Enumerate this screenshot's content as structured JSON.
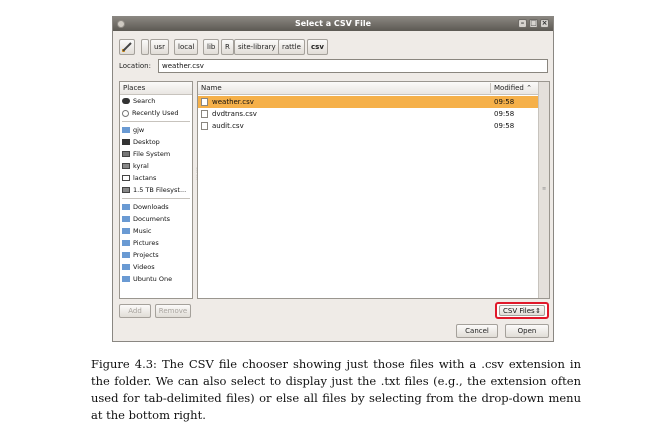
{
  "window": {
    "title": "Select a CSV File",
    "controls": [
      "minimize-icon",
      "maximize-icon",
      "close-icon"
    ]
  },
  "path_bar": {
    "edit_icon": "pencil-icon",
    "crumbs": [
      "usr",
      "local",
      "lib",
      "R",
      "site-library",
      "rattle",
      "csv"
    ]
  },
  "location": {
    "label": "Location:",
    "value": "weather.csv"
  },
  "places": {
    "header": "Places",
    "items": [
      {
        "label": "Search",
        "icon": "binoculars-icon"
      },
      {
        "label": "Recently Used",
        "icon": "clock-icon"
      },
      {
        "label": "gjw",
        "icon": "folder-home-icon"
      },
      {
        "label": "Desktop",
        "icon": "desktop-icon"
      },
      {
        "label": "File System",
        "icon": "drive-icon"
      },
      {
        "label": "kyral",
        "icon": "drive-icon"
      },
      {
        "label": "lactans",
        "icon": "drive-icon"
      },
      {
        "label": "1.5 TB Filesyst...",
        "icon": "drive-icon"
      },
      {
        "label": "Downloads",
        "icon": "folder-icon"
      },
      {
        "label": "Documents",
        "icon": "folder-icon"
      },
      {
        "label": "Music",
        "icon": "folder-icon"
      },
      {
        "label": "Pictures",
        "icon": "folder-icon"
      },
      {
        "label": "Projects",
        "icon": "folder-icon"
      },
      {
        "label": "Videos",
        "icon": "folder-icon"
      },
      {
        "label": "Ubuntu One",
        "icon": "folder-icon"
      }
    ],
    "add_label": "Add",
    "remove_label": "Remove"
  },
  "files": {
    "col_name": "Name",
    "col_modified": "Modified",
    "sort_icon": "sort-ascending-icon",
    "rows": [
      {
        "name": "weather.csv",
        "modified": "09:58",
        "selected": true
      },
      {
        "name": "dvdtrans.csv",
        "modified": "09:58",
        "selected": false
      },
      {
        "name": "audit.csv",
        "modified": "09:58",
        "selected": false
      }
    ]
  },
  "filter": {
    "selected": "CSV Files",
    "highlight_color": "#e0182a"
  },
  "buttons": {
    "cancel": "Cancel",
    "open": "Open"
  },
  "colors": {
    "selection": "#f5b049",
    "title_bar": "#5c5953"
  },
  "caption": {
    "text": "Figure 4.3: The CSV file chooser showing just those files with a .csv extension in the folder. We can also select to display just the .txt files (e.g., the extension often used for tab-delimited files) or else all files by selecting from the drop-down menu at the bottom right."
  }
}
